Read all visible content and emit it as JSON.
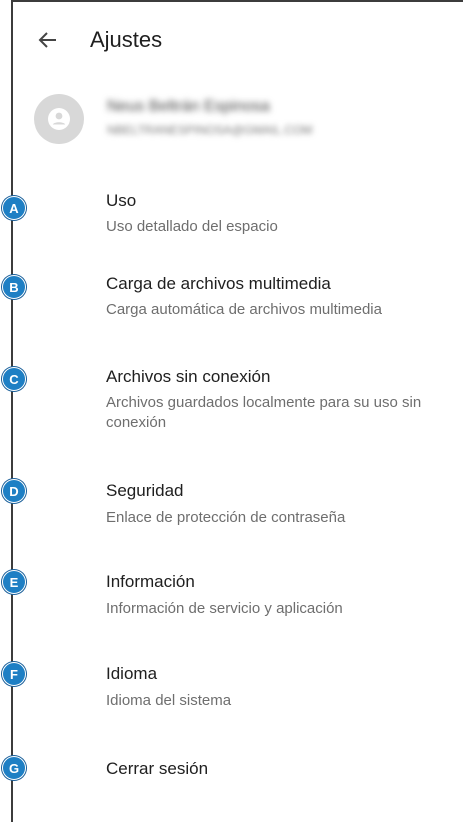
{
  "header": {
    "title": "Ajustes",
    "back_icon": "arrow-left-icon"
  },
  "account": {
    "name": "Neus Beltrán Espinosa",
    "email": "NBELTRANESPINOSA@GMAIL.COM",
    "avatar_icon": "user-avatar-icon"
  },
  "colors": {
    "badge": "#1e7fc4",
    "title_text": "#202020",
    "subtitle_text": "#6e6e6e"
  },
  "items": [
    {
      "badge": "A",
      "title": "Uso",
      "subtitle": "Uso detallado del espacio"
    },
    {
      "badge": "B",
      "title": "Carga de archivos multimedia",
      "subtitle": "Carga automática de archivos multimedia"
    },
    {
      "badge": "C",
      "title": "Archivos sin conexión",
      "subtitle": "Archivos guardados localmente para su uso sin conexión"
    },
    {
      "badge": "D",
      "title": "Seguridad",
      "subtitle": "Enlace de protección de contraseña"
    },
    {
      "badge": "E",
      "title": "Información",
      "subtitle": "Información de servicio y aplicación"
    },
    {
      "badge": "F",
      "title": "Idioma",
      "subtitle": "Idioma del sistema"
    },
    {
      "badge": "G",
      "title": "Cerrar sesión",
      "subtitle": ""
    }
  ]
}
